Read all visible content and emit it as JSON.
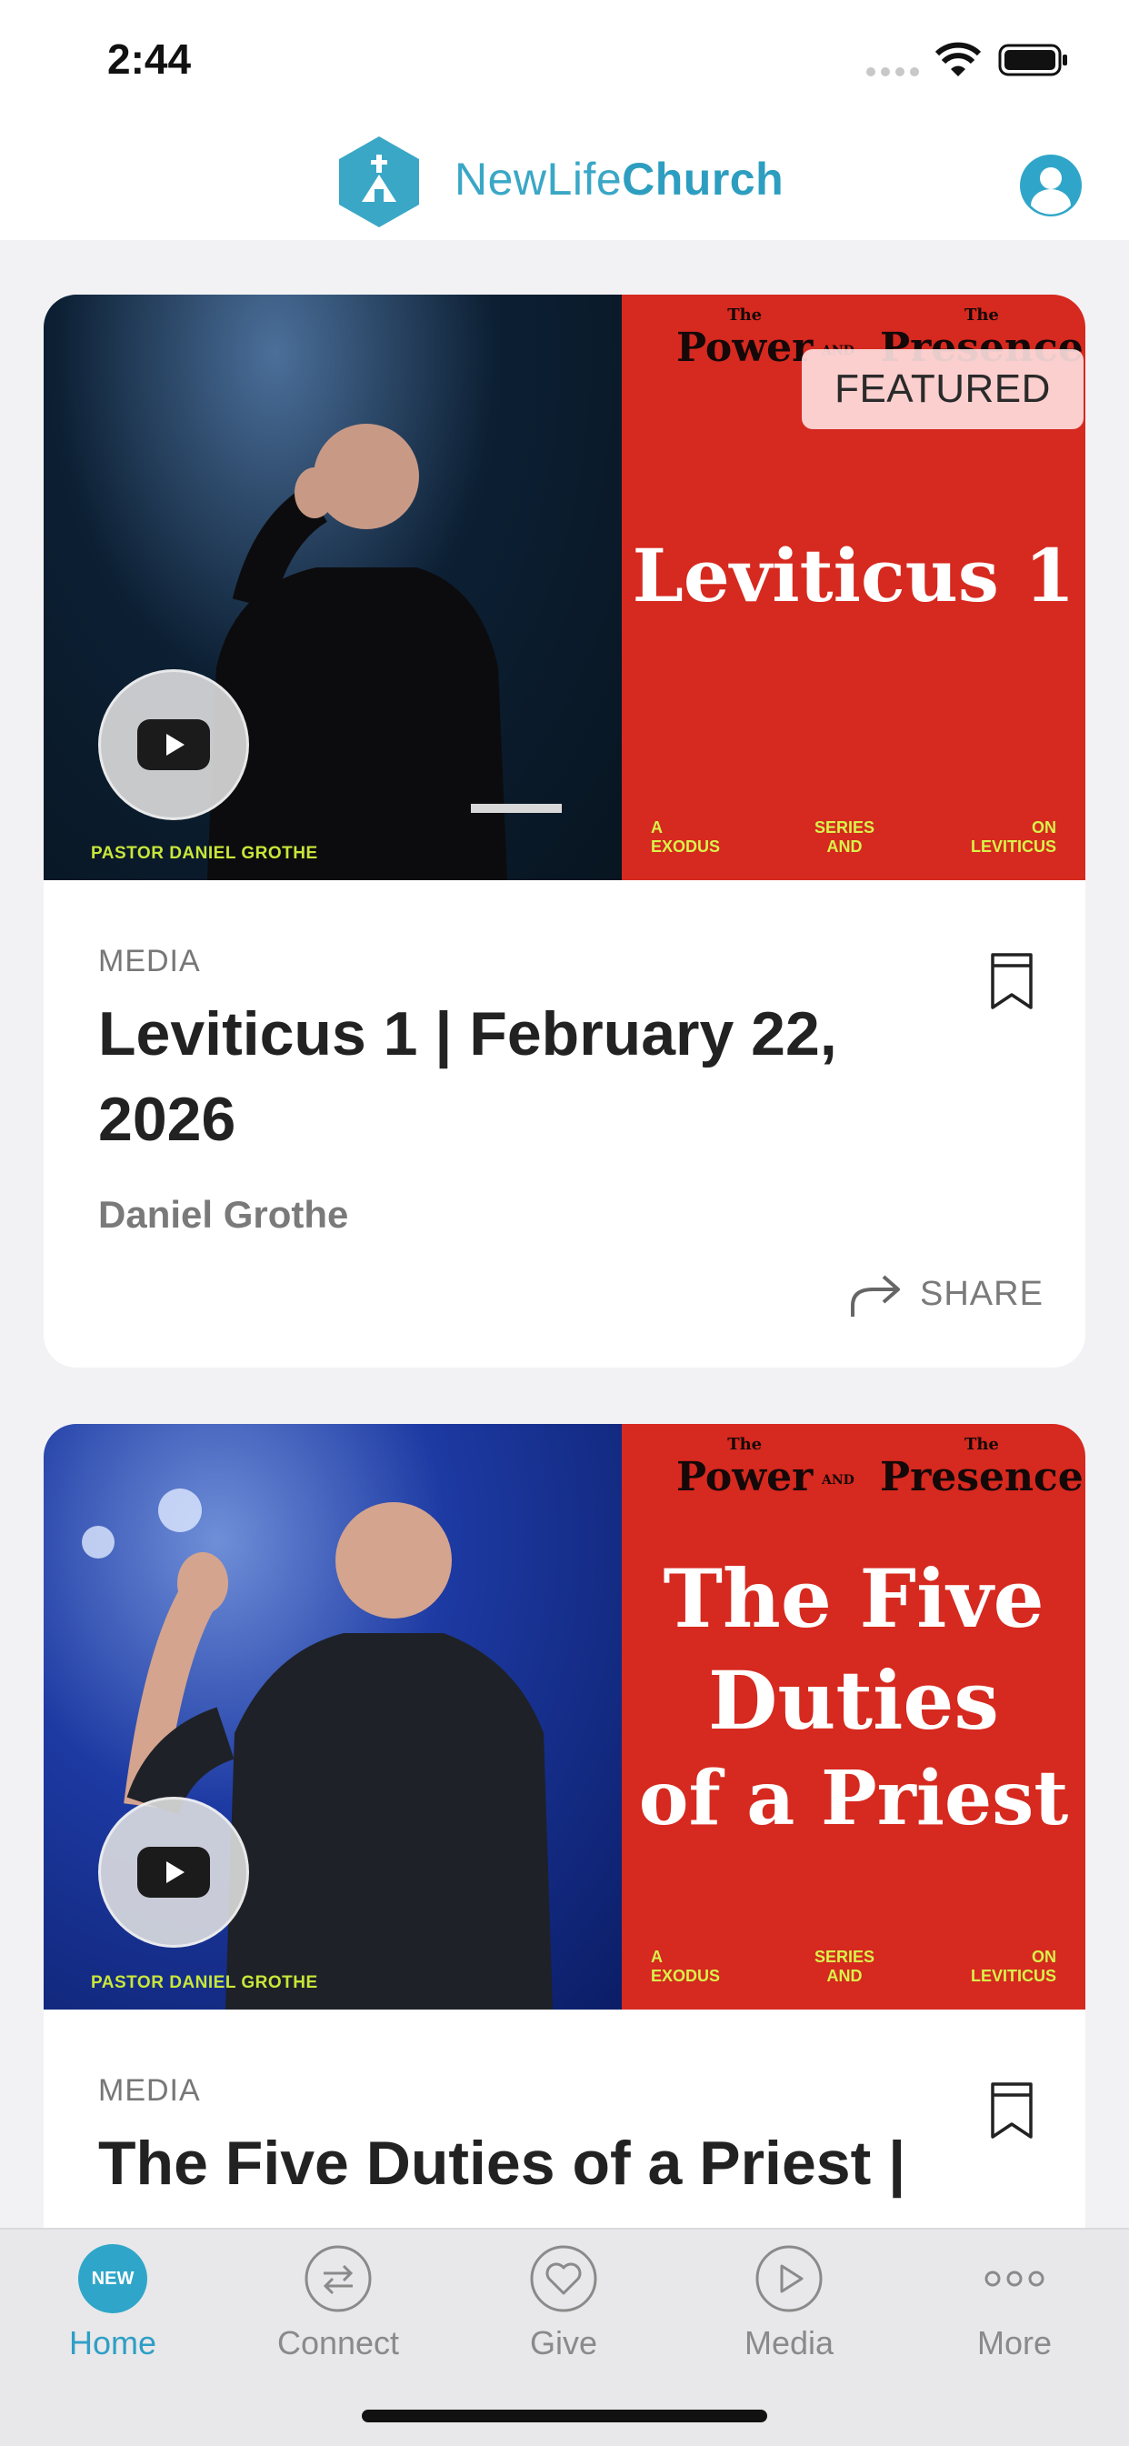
{
  "status_bar": {
    "time": "2:44"
  },
  "header": {
    "brand_regular": "NewLife",
    "brand_bold": "Church",
    "icons": [
      "church-logo-icon",
      "profile-icon"
    ]
  },
  "colors": {
    "accent": "#2fa6c9",
    "art_red": "#d6291f",
    "art_lime": "#c8e63a"
  },
  "cards": [
    {
      "badge": "FEATURED",
      "pastor_caption": "PASTOR DANIEL GROTHE",
      "art_top_left_small": "The",
      "art_top_left": "Power",
      "art_top_mid": "AND",
      "art_top_right_small": "The",
      "art_top_right": "Presence",
      "art_title": "Leviticus 1",
      "art_foot_left": "A\nEXODUS",
      "art_foot_mid": "SERIES\nAND",
      "art_foot_right": "ON\nLEVITICUS",
      "category": "MEDIA",
      "title": "Leviticus 1 | February 22, 2026",
      "author": "Daniel Grothe",
      "share_label": "SHARE"
    },
    {
      "pastor_caption": "PASTOR DANIEL GROTHE",
      "art_top_left_small": "The",
      "art_top_left": "Power",
      "art_top_mid": "AND",
      "art_top_right_small": "The",
      "art_top_right": "Presence",
      "art_title_1": "The Five",
      "art_title_2": "Duties",
      "art_title_3": "of a Priest",
      "art_foot_left": "A\nEXODUS",
      "art_foot_mid": "SERIES\nAND",
      "art_foot_right": "ON\nLEVITICUS",
      "category": "MEDIA",
      "title": "The Five Duties of a Priest |"
    }
  ],
  "tabs": [
    {
      "label": "Home",
      "badge": "NEW",
      "active": true
    },
    {
      "label": "Connect",
      "icon": "connect-arrows-icon"
    },
    {
      "label": "Give",
      "icon": "heart-icon"
    },
    {
      "label": "Media",
      "icon": "play-icon"
    },
    {
      "label": "More",
      "icon": "more-dots-icon"
    }
  ]
}
